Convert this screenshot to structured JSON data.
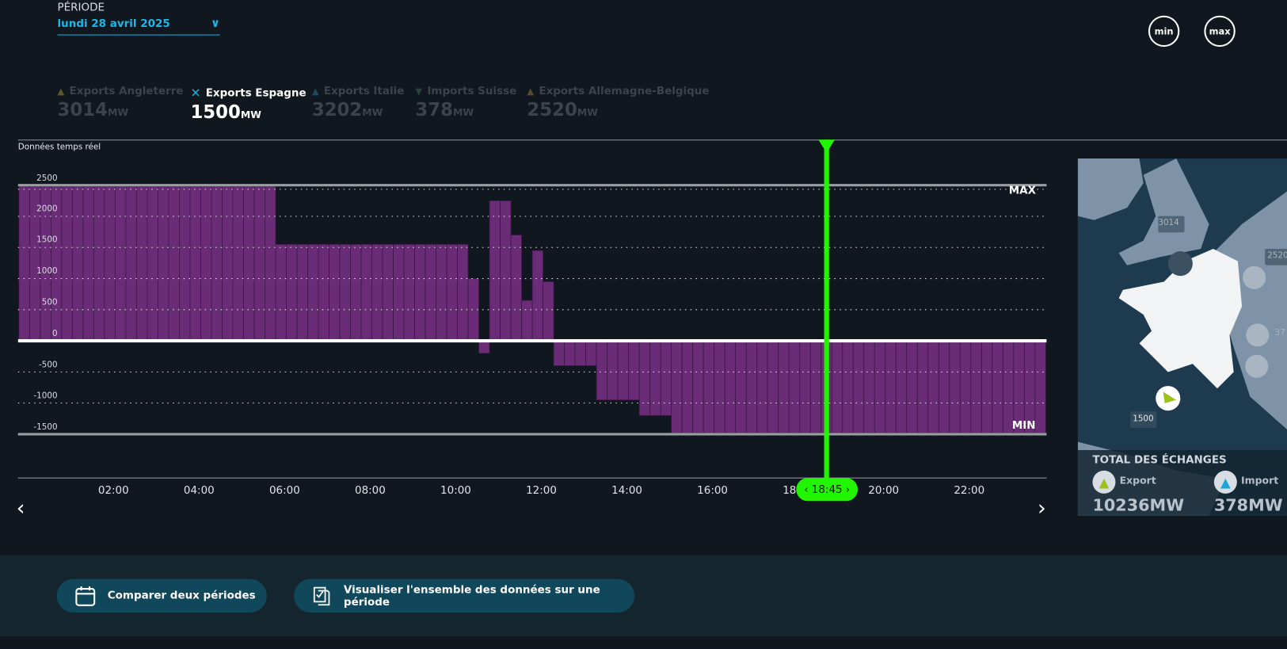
{
  "periode": {
    "label": "PÉRIODE",
    "value": "lundi 28 avril 2025"
  },
  "zoom_buttons": {
    "min": "min",
    "max": "max"
  },
  "legend": [
    {
      "name": "Exports Angleterre",
      "value": "3014",
      "unit": "MW",
      "icon": "arrow-up-icon",
      "color": "#5d5a2a",
      "active": false
    },
    {
      "name": "Exports Espagne",
      "value": "1500",
      "unit": "MW",
      "icon": "close-icon",
      "color": "#1ab0d6",
      "active": true
    },
    {
      "name": "Exports Italie",
      "value": "3202",
      "unit": "MW",
      "icon": "arrow-up-icon",
      "color": "#1e4a5f",
      "active": false
    },
    {
      "name": "Imports Suisse",
      "value": "378",
      "unit": "MW",
      "icon": "arrow-down-icon",
      "color": "#294436",
      "active": false
    },
    {
      "name": "Exports Allemagne-Belgique",
      "value": "2520",
      "unit": "MW",
      "icon": "arrow-up-icon",
      "color": "#5a4a33",
      "active": false
    }
  ],
  "chart_data": {
    "type": "bar",
    "title": "Données temps réel",
    "interval_minutes": 15,
    "ylim": [
      -1500,
      2500
    ],
    "yticks": [
      "2500",
      "2000",
      "1500",
      "1000",
      "500",
      "0",
      "-500",
      "-1000",
      "-1500"
    ],
    "yticks_values": [
      2500,
      2000,
      1500,
      1000,
      500,
      0,
      -500,
      -1000,
      -1500
    ],
    "xticks": [
      "02:00",
      "04:00",
      "06:00",
      "08:00",
      "10:00",
      "12:00",
      "14:00",
      "16:00",
      "18:00",
      "20:00",
      "22:00"
    ],
    "max_label": "MAX",
    "min_label": "MIN",
    "max_value": 2500,
    "min_value": -1500,
    "bar_color": "#6a2c77",
    "segments": [
      {
        "count": 24,
        "value": 2480
      },
      {
        "count": 18,
        "value": 1550
      },
      {
        "count": 1,
        "value": 1000
      },
      {
        "count": 1,
        "value": -200
      },
      {
        "count": 2,
        "value": 2250
      },
      {
        "count": 1,
        "value": 1700
      },
      {
        "count": 1,
        "value": 650
      },
      {
        "count": 1,
        "value": 1450
      },
      {
        "count": 1,
        "value": 950
      },
      {
        "count": 4,
        "value": -400
      },
      {
        "count": 4,
        "value": -950
      },
      {
        "count": 3,
        "value": -1200
      },
      {
        "count": 35,
        "value": -1480
      }
    ],
    "cursor": {
      "time": "18:45",
      "bar_index": 75,
      "color": "#22f500"
    }
  },
  "map": {
    "labels": {
      "angleterre": "3014",
      "allemagne": "2520",
      "suisse": "37",
      "espagne": "1500"
    },
    "total_title": "TOTAL DES ÉCHANGES",
    "export_label": "Export",
    "export_value": "10236MW",
    "import_label": "Import",
    "import_value": "378MW"
  },
  "actions": {
    "compare": "Comparer deux périodes",
    "visualize": "Visualiser l'ensemble des données sur une période"
  }
}
